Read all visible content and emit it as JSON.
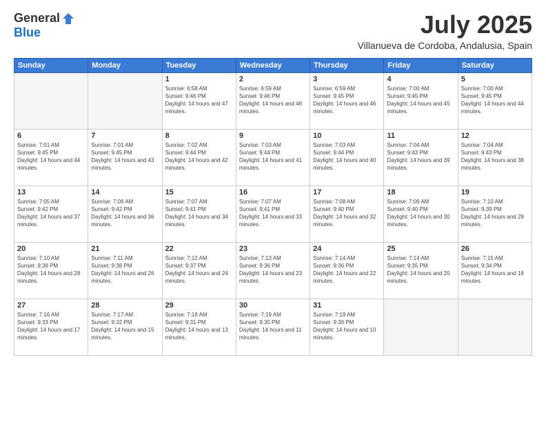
{
  "header": {
    "logo_general": "General",
    "logo_blue": "Blue",
    "month_title": "July 2025",
    "location": "Villanueva de Cordoba, Andalusia, Spain"
  },
  "days_of_week": [
    "Sunday",
    "Monday",
    "Tuesday",
    "Wednesday",
    "Thursday",
    "Friday",
    "Saturday"
  ],
  "weeks": [
    [
      {
        "day": "",
        "info": ""
      },
      {
        "day": "",
        "info": ""
      },
      {
        "day": "1",
        "info": "Sunrise: 6:58 AM\nSunset: 9:46 PM\nDaylight: 14 hours and 47 minutes."
      },
      {
        "day": "2",
        "info": "Sunrise: 6:59 AM\nSunset: 9:46 PM\nDaylight: 14 hours and 46 minutes."
      },
      {
        "day": "3",
        "info": "Sunrise: 6:59 AM\nSunset: 9:45 PM\nDaylight: 14 hours and 46 minutes."
      },
      {
        "day": "4",
        "info": "Sunrise: 7:00 AM\nSunset: 9:45 PM\nDaylight: 14 hours and 45 minutes."
      },
      {
        "day": "5",
        "info": "Sunrise: 7:00 AM\nSunset: 9:45 PM\nDaylight: 14 hours and 44 minutes."
      }
    ],
    [
      {
        "day": "6",
        "info": "Sunrise: 7:01 AM\nSunset: 9:45 PM\nDaylight: 14 hours and 44 minutes."
      },
      {
        "day": "7",
        "info": "Sunrise: 7:01 AM\nSunset: 9:45 PM\nDaylight: 14 hours and 43 minutes."
      },
      {
        "day": "8",
        "info": "Sunrise: 7:02 AM\nSunset: 9:44 PM\nDaylight: 14 hours and 42 minutes."
      },
      {
        "day": "9",
        "info": "Sunrise: 7:03 AM\nSunset: 9:44 PM\nDaylight: 14 hours and 41 minutes."
      },
      {
        "day": "10",
        "info": "Sunrise: 7:03 AM\nSunset: 9:44 PM\nDaylight: 14 hours and 40 minutes."
      },
      {
        "day": "11",
        "info": "Sunrise: 7:04 AM\nSunset: 9:43 PM\nDaylight: 14 hours and 39 minutes."
      },
      {
        "day": "12",
        "info": "Sunrise: 7:04 AM\nSunset: 9:43 PM\nDaylight: 14 hours and 38 minutes."
      }
    ],
    [
      {
        "day": "13",
        "info": "Sunrise: 7:05 AM\nSunset: 9:42 PM\nDaylight: 14 hours and 37 minutes."
      },
      {
        "day": "14",
        "info": "Sunrise: 7:06 AM\nSunset: 9:42 PM\nDaylight: 14 hours and 36 minutes."
      },
      {
        "day": "15",
        "info": "Sunrise: 7:07 AM\nSunset: 9:41 PM\nDaylight: 14 hours and 34 minutes."
      },
      {
        "day": "16",
        "info": "Sunrise: 7:07 AM\nSunset: 9:41 PM\nDaylight: 14 hours and 33 minutes."
      },
      {
        "day": "17",
        "info": "Sunrise: 7:08 AM\nSunset: 9:40 PM\nDaylight: 14 hours and 32 minutes."
      },
      {
        "day": "18",
        "info": "Sunrise: 7:09 AM\nSunset: 9:40 PM\nDaylight: 14 hours and 30 minutes."
      },
      {
        "day": "19",
        "info": "Sunrise: 7:10 AM\nSunset: 9:39 PM\nDaylight: 14 hours and 29 minutes."
      }
    ],
    [
      {
        "day": "20",
        "info": "Sunrise: 7:10 AM\nSunset: 9:38 PM\nDaylight: 14 hours and 28 minutes."
      },
      {
        "day": "21",
        "info": "Sunrise: 7:11 AM\nSunset: 9:38 PM\nDaylight: 14 hours and 26 minutes."
      },
      {
        "day": "22",
        "info": "Sunrise: 7:12 AM\nSunset: 9:37 PM\nDaylight: 14 hours and 24 minutes."
      },
      {
        "day": "23",
        "info": "Sunrise: 7:13 AM\nSunset: 9:36 PM\nDaylight: 14 hours and 23 minutes."
      },
      {
        "day": "24",
        "info": "Sunrise: 7:14 AM\nSunset: 9:36 PM\nDaylight: 14 hours and 22 minutes."
      },
      {
        "day": "25",
        "info": "Sunrise: 7:14 AM\nSunset: 9:35 PM\nDaylight: 14 hours and 20 minutes."
      },
      {
        "day": "26",
        "info": "Sunrise: 7:15 AM\nSunset: 9:34 PM\nDaylight: 14 hours and 18 minutes."
      }
    ],
    [
      {
        "day": "27",
        "info": "Sunrise: 7:16 AM\nSunset: 9:33 PM\nDaylight: 14 hours and 17 minutes."
      },
      {
        "day": "28",
        "info": "Sunrise: 7:17 AM\nSunset: 9:32 PM\nDaylight: 14 hours and 15 minutes."
      },
      {
        "day": "29",
        "info": "Sunrise: 7:18 AM\nSunset: 9:31 PM\nDaylight: 14 hours and 13 minutes."
      },
      {
        "day": "30",
        "info": "Sunrise: 7:19 AM\nSunset: 9:30 PM\nDaylight: 14 hours and 11 minutes."
      },
      {
        "day": "31",
        "info": "Sunrise: 7:19 AM\nSunset: 9:30 PM\nDaylight: 14 hours and 10 minutes."
      },
      {
        "day": "",
        "info": ""
      },
      {
        "day": "",
        "info": ""
      }
    ]
  ]
}
